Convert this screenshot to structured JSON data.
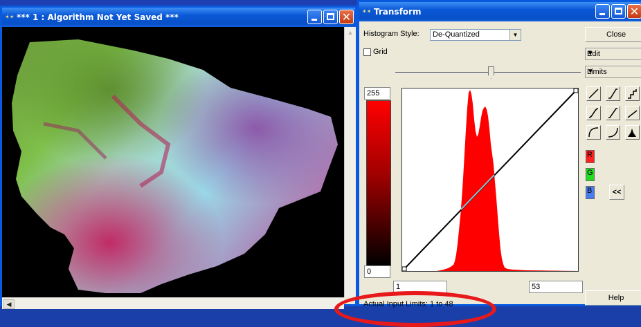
{
  "image_window": {
    "title": "*** 1 : Algorithm Not Yet Saved ***"
  },
  "transform_window": {
    "title": "Transform",
    "histogram_style_label": "Histogram Style:",
    "histogram_style_value": "De-Quantized",
    "grid_label": "Grid",
    "output_max": "255",
    "output_min": "0",
    "input_min": "1",
    "input_max": "53",
    "status_text": "Actual Input Limits: 1 to 48",
    "close_label": "Close",
    "edit_label": "Edit",
    "limits_label": "Limits",
    "help_label": "Help",
    "channel_r": "R",
    "channel_g": "G",
    "channel_b": "B",
    "collapse_label": "<<"
  },
  "colors": {
    "histogram": "#ff0000",
    "transform_line": "#000000",
    "transform_line_highlight": "#87c5cf",
    "channel_r": "#ff2020",
    "channel_g": "#22dd22",
    "channel_b": "#4a7cf0",
    "annotation_circle": "#e8191a"
  }
}
